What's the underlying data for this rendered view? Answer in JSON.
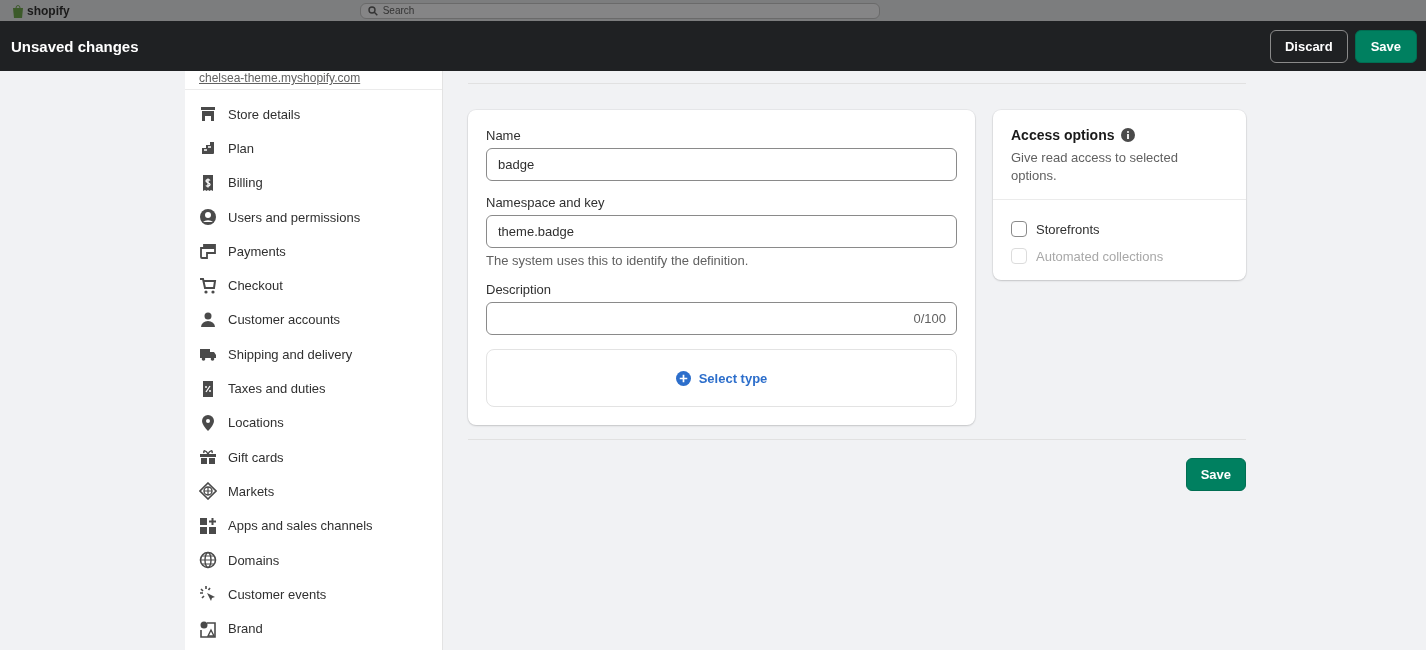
{
  "app_header": {
    "logo": "shopify",
    "search": {
      "placeholder": "Search"
    }
  },
  "save_bar": {
    "title": "Unsaved changes",
    "buttons": [
      {
        "label": "Discard",
        "kind": "secondary"
      },
      {
        "label": "Save",
        "kind": "primary"
      }
    ]
  },
  "sidebar": {
    "store_url": "chelsea-theme.myshopify.com",
    "items": [
      {
        "label": "Store details",
        "selected": false
      },
      {
        "label": "Plan",
        "selected": false
      },
      {
        "label": "Billing",
        "selected": false
      },
      {
        "label": "Users and permissions",
        "selected": false
      },
      {
        "label": "Payments",
        "selected": false
      },
      {
        "label": "Checkout",
        "selected": false
      },
      {
        "label": "Customer accounts",
        "selected": false
      },
      {
        "label": "Shipping and delivery",
        "selected": false
      },
      {
        "label": "Taxes and duties",
        "selected": false
      },
      {
        "label": "Locations",
        "selected": false
      },
      {
        "label": "Gift cards",
        "selected": false
      },
      {
        "label": "Markets",
        "selected": false
      },
      {
        "label": "Apps and sales channels",
        "selected": false
      },
      {
        "label": "Domains",
        "selected": false
      },
      {
        "label": "Customer events",
        "selected": false
      },
      {
        "label": "Brand",
        "selected": false
      }
    ]
  },
  "definition_form": {
    "fields": [
      {
        "label": "Name",
        "value": "badge"
      },
      {
        "label": "Namespace and key",
        "value": "theme.badge",
        "help": "The system uses this to identify the definition."
      },
      {
        "label": "Description",
        "counter": "0/100"
      }
    ],
    "select_type": "Select type"
  },
  "access_options": {
    "title": "Access options",
    "description": "Give read access to selected options.",
    "options": [
      {
        "label": "Storefronts",
        "checked": false,
        "disabled": false
      },
      {
        "label": "Automated collections",
        "checked": false,
        "disabled": true
      }
    ]
  },
  "footer": {
    "save": "Save"
  }
}
